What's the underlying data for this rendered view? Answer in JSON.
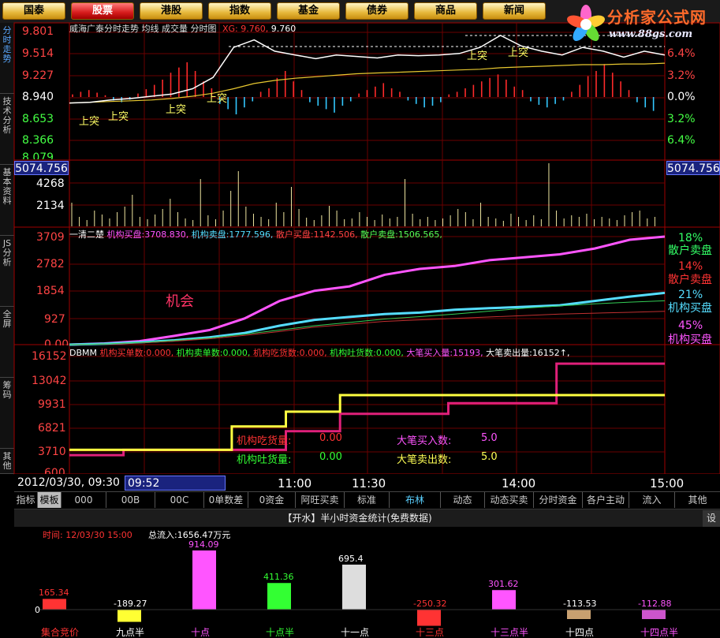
{
  "top_menu": [
    "国泰",
    "股票",
    "港股",
    "指数",
    "基金",
    "债券",
    "商品",
    "新闻"
  ],
  "logo": {
    "title": "分析家公式网",
    "url": "www.88gs.com"
  },
  "side_tabs": [
    "分时走势",
    "技术分析",
    "基本资料",
    "JS分析",
    "全屏",
    "筹码",
    "其他"
  ],
  "price_panel": {
    "title": "威海广泰分时走势 均线 成交量 分时图",
    "xg_label": "XG: 9.760,",
    "xg_value": "9.760",
    "y_ticks": [
      "9.801",
      "9.514",
      "9.227",
      "8.940",
      "8.653",
      "8.366",
      "8.079"
    ],
    "pct_ticks": [
      "6.4%",
      "3.2%",
      "0.0%",
      "3.2%",
      "6.4%"
    ],
    "signal": "上突"
  },
  "volume_panel": {
    "box_value": "5074.756",
    "y_ticks": [
      "4268",
      "2134"
    ]
  },
  "flow_panel": {
    "header_prefix": "一清二楚",
    "header_items": [
      {
        "label": "机构买盘:",
        "value": "3708.830,"
      },
      {
        "label": "机构卖盘:",
        "value": "1777.596,"
      },
      {
        "label": "散户买盘:",
        "value": "1142.506,"
      },
      {
        "label": "散户卖盘:",
        "value": "1506.565,"
      }
    ],
    "y_ticks": [
      "3709",
      "2782",
      "1854",
      "927",
      "0.00"
    ],
    "annotation": "机会",
    "legend": [
      {
        "pct": "18%",
        "label": "散户卖盘",
        "color": "#33ff66"
      },
      {
        "pct": "14%",
        "label": "散户卖盘",
        "color": "#ff3333"
      },
      {
        "pct": "21%",
        "label": "机构买盘",
        "color": "#55ddff"
      },
      {
        "pct": "45%",
        "label": "机构买盘",
        "color": "#ff55ff"
      }
    ]
  },
  "dbmm_panel": {
    "header_prefix": "DBMM",
    "header_items": [
      {
        "label": "机构买单数:",
        "value": "0.000,"
      },
      {
        "label": "机构卖单数:",
        "value": "0.000,"
      },
      {
        "label": "机构吃货数:",
        "value": "0.000,"
      },
      {
        "label": "机构吐货数:",
        "value": "0.000,"
      },
      {
        "label": "大笔买入量:",
        "value": "15193,"
      },
      {
        "label": "大笔卖出量:",
        "value": "16152↑,"
      }
    ],
    "y_ticks": [
      "16152",
      "13042",
      "9931",
      "6821",
      "3710",
      "600"
    ],
    "stats": [
      {
        "label": "机构吃货量:",
        "value": "0.00"
      },
      {
        "label": "机构吐货量:",
        "value": "0.00"
      },
      {
        "label": "大笔买入数:",
        "value": "5.0"
      },
      {
        "label": "大笔卖出数:",
        "value": "5.0"
      }
    ]
  },
  "time_axis": {
    "datetime": "2012/03/30, 09:30",
    "cursor_time": "09:52",
    "ticks": [
      "11:00",
      "11:30",
      "14:00",
      "15:00"
    ]
  },
  "bottom_tabs": [
    "指标",
    "模板",
    "000",
    "00B",
    "00C",
    "0单数差",
    "0资金",
    "阿旺买卖",
    "标准",
    "布林",
    "动态",
    "动态买卖",
    "分时资金",
    "各户主动",
    "流入",
    "其他"
  ],
  "bottom_selected_tab": "布林",
  "capital_panel": {
    "title": "【开水】半小时资金统计(免费数据)",
    "settings_label": "设",
    "time_label": "时间: 12/03/30 15:00",
    "total_label": "总流入:1656.47万元",
    "zero_label": "0"
  },
  "chart_data": [
    {
      "type": "line",
      "title": "威海广泰分时走势",
      "ylim": [
        8.079,
        9.801
      ],
      "y_ticks": [
        9.801,
        9.514,
        9.227,
        8.94,
        8.653,
        8.366,
        8.079
      ],
      "series": [
        {
          "name": "分时",
          "values": [
            8.86,
            8.87,
            8.9,
            8.92,
            8.95,
            8.98,
            9.05,
            9.2,
            9.6,
            9.7,
            9.55,
            9.5,
            9.45,
            9.5,
            9.48,
            9.46,
            9.5,
            9.49,
            9.5,
            9.52,
            9.6,
            9.76,
            9.62,
            9.55,
            9.5,
            9.6,
            9.55,
            9.47,
            9.55,
            9.5
          ]
        },
        {
          "name": "均线",
          "values": [
            8.86,
            8.87,
            8.88,
            8.89,
            8.9,
            8.92,
            8.95,
            8.99,
            9.05,
            9.12,
            9.16,
            9.19,
            9.21,
            9.23,
            9.25,
            9.26,
            9.27,
            9.28,
            9.29,
            9.3,
            9.31,
            9.33,
            9.34,
            9.35,
            9.36,
            9.37,
            9.37,
            9.38,
            9.38,
            9.39
          ]
        }
      ]
    },
    {
      "type": "line",
      "title": "一清二楚",
      "ylim": [
        0,
        3709
      ],
      "series": [
        {
          "name": "机构买盘",
          "values": [
            0,
            40,
            120,
            300,
            500,
            900,
            1500,
            1850,
            2000,
            2400,
            2600,
            2700,
            2900,
            3000,
            3100,
            3300,
            3600,
            3709
          ]
        },
        {
          "name": "机构卖盘",
          "values": [
            0,
            30,
            80,
            150,
            250,
            400,
            650,
            850,
            950,
            1050,
            1100,
            1200,
            1250,
            1300,
            1350,
            1500,
            1650,
            1777
          ]
        },
        {
          "name": "散户买盘",
          "values": [
            0,
            20,
            60,
            120,
            200,
            320,
            450,
            600,
            700,
            800,
            850,
            900,
            950,
            1000,
            1050,
            1080,
            1110,
            1142
          ]
        },
        {
          "name": "散户卖盘",
          "values": [
            0,
            25,
            70,
            140,
            230,
            360,
            500,
            650,
            760,
            880,
            960,
            1050,
            1150,
            1250,
            1330,
            1400,
            1460,
            1506
          ]
        }
      ]
    },
    {
      "type": "line",
      "title": "DBMM",
      "ylim": [
        600,
        16152
      ],
      "series": [
        {
          "name": "大笔买入量",
          "values": [
            3000,
            3710,
            3710,
            3710,
            6200,
            8500,
            8500,
            9931,
            9931,
            15193,
            15193,
            15193
          ]
        },
        {
          "name": "大笔卖出量",
          "values": [
            3710,
            3710,
            3710,
            6821,
            8800,
            11000,
            11000,
            11000,
            11000,
            11000,
            11000,
            11000
          ]
        }
      ]
    },
    {
      "type": "bar",
      "title": "半小时资金统计",
      "categories": [
        "集合竞价",
        "九点半",
        "十点",
        "十点半",
        "十一点",
        "十三点",
        "十三点半",
        "十四点",
        "十四点半"
      ],
      "values": [
        165.34,
        -189.27,
        914.09,
        411.36,
        695.4,
        -250.32,
        301.62,
        -113.53,
        -112.88
      ],
      "value_labels": [
        "165.34",
        "-189.27",
        "914.09",
        "411.36",
        "695.4",
        "-250.32",
        "301.62",
        "-113.53",
        "-112.88"
      ],
      "colors": [
        "#ff3333",
        "#ffff33",
        "#ff55ff",
        "#33ff33",
        "#dddddd",
        "#ff3333",
        "#ff55ff",
        "#c8a070",
        "#cc55cc"
      ],
      "label_colors": [
        "#ff3333",
        "#ffffff",
        "#ff55ff",
        "#33ff33",
        "#ffffff",
        "#ff3333",
        "#ff55ff",
        "#ffffff",
        "#ff55ff"
      ]
    }
  ]
}
